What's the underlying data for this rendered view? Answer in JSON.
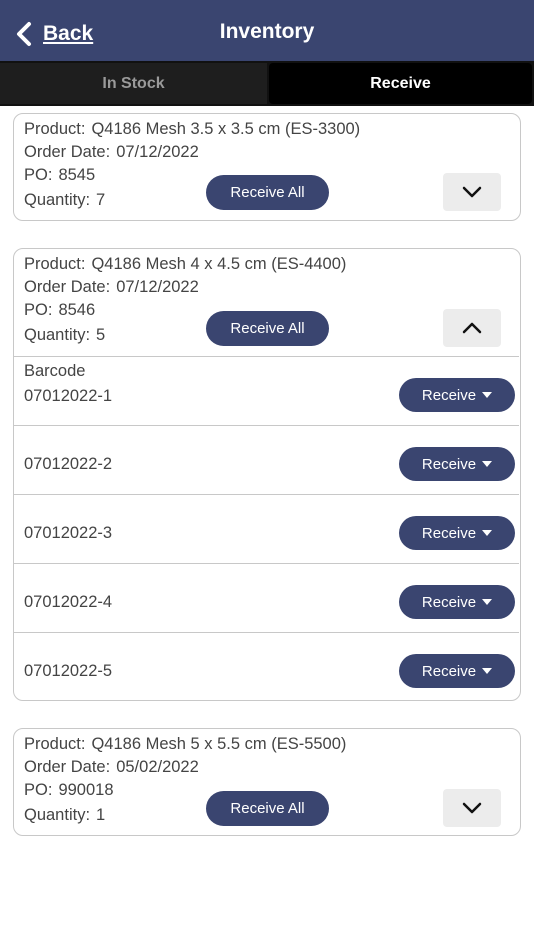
{
  "nav": {
    "back_label": "Back",
    "title": "Inventory"
  },
  "tabs": [
    {
      "label": "In Stock",
      "active": false
    },
    {
      "label": "Receive",
      "active": true
    }
  ],
  "labels": {
    "product": "Product:",
    "order_date": "Order Date:",
    "po": "PO:",
    "quantity": "Quantity:",
    "receive_all": "Receive All",
    "barcode": "Barcode",
    "receive": "Receive"
  },
  "orders": [
    {
      "product": "Q4186 Mesh 3.5 x 3.5 cm (ES-3300)",
      "order_date": "07/12/2022",
      "po": "8545",
      "quantity": "7",
      "expanded": false
    },
    {
      "product": "Q4186 Mesh 4 x 4.5 cm (ES-4400)",
      "order_date": "07/12/2022",
      "po": "8546",
      "quantity": "5",
      "expanded": true,
      "barcodes": [
        "07012022-1",
        "07012022-2",
        "07012022-3",
        "07012022-4",
        "07012022-5"
      ]
    },
    {
      "product": "Q4186 Mesh 5 x 5.5 cm (ES-5500)",
      "order_date": "05/02/2022",
      "po": "990018",
      "quantity": "1",
      "expanded": false
    }
  ],
  "colors": {
    "primary": "#3a4570",
    "tabbar": "#111111",
    "border": "#c8c8c8",
    "toggle_bg": "#ececec"
  },
  "icons": {
    "back": "chevron-left-icon",
    "collapsed": "chevron-down-icon",
    "expanded": "chevron-up-icon",
    "dropdown": "caret-down-icon"
  }
}
